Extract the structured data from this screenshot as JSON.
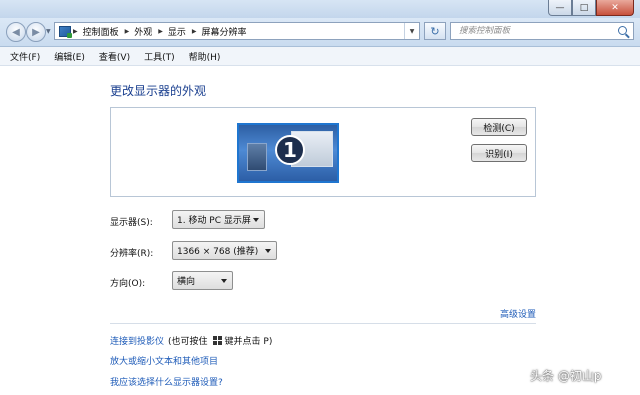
{
  "window": {
    "minimize": "—",
    "maximize": "□",
    "close": "✕"
  },
  "nav": {
    "back_icon": "back-arrow-icon",
    "forward_icon": "forward-arrow-icon"
  },
  "address": {
    "crumbs": [
      "控制面板",
      "外观",
      "显示",
      "屏幕分辨率"
    ],
    "refresh_glyph": "↻",
    "search_placeholder": "搜索控制面板"
  },
  "menu": [
    "文件(F)",
    "编辑(E)",
    "查看(V)",
    "工具(T)",
    "帮助(H)"
  ],
  "main": {
    "title": "更改显示器的外观",
    "monitor_number": "1",
    "detect_button": "检测(C)",
    "identify_button": "识别(I)",
    "display_label": "显示器(S):",
    "display_value": "1. 移动 PC 显示屏",
    "resolution_label": "分辨率(R):",
    "resolution_value": "1366 × 768 (推荐)",
    "orientation_label": "方向(O):",
    "orientation_value": "横向",
    "advanced_link": "高级设置",
    "projector_link": "连接到投影仪",
    "projector_note_a": "(也可按住",
    "projector_note_b": "键并点击 P)",
    "text_size_link": "放大或缩小文本和其他项目",
    "help_link": "我应该选择什么显示器设置?"
  },
  "watermark": "头条 @初山p",
  "colors": {
    "link": "#1e5bb8",
    "title": "#1a3f8f",
    "monitor_border": "#1f76d0"
  }
}
